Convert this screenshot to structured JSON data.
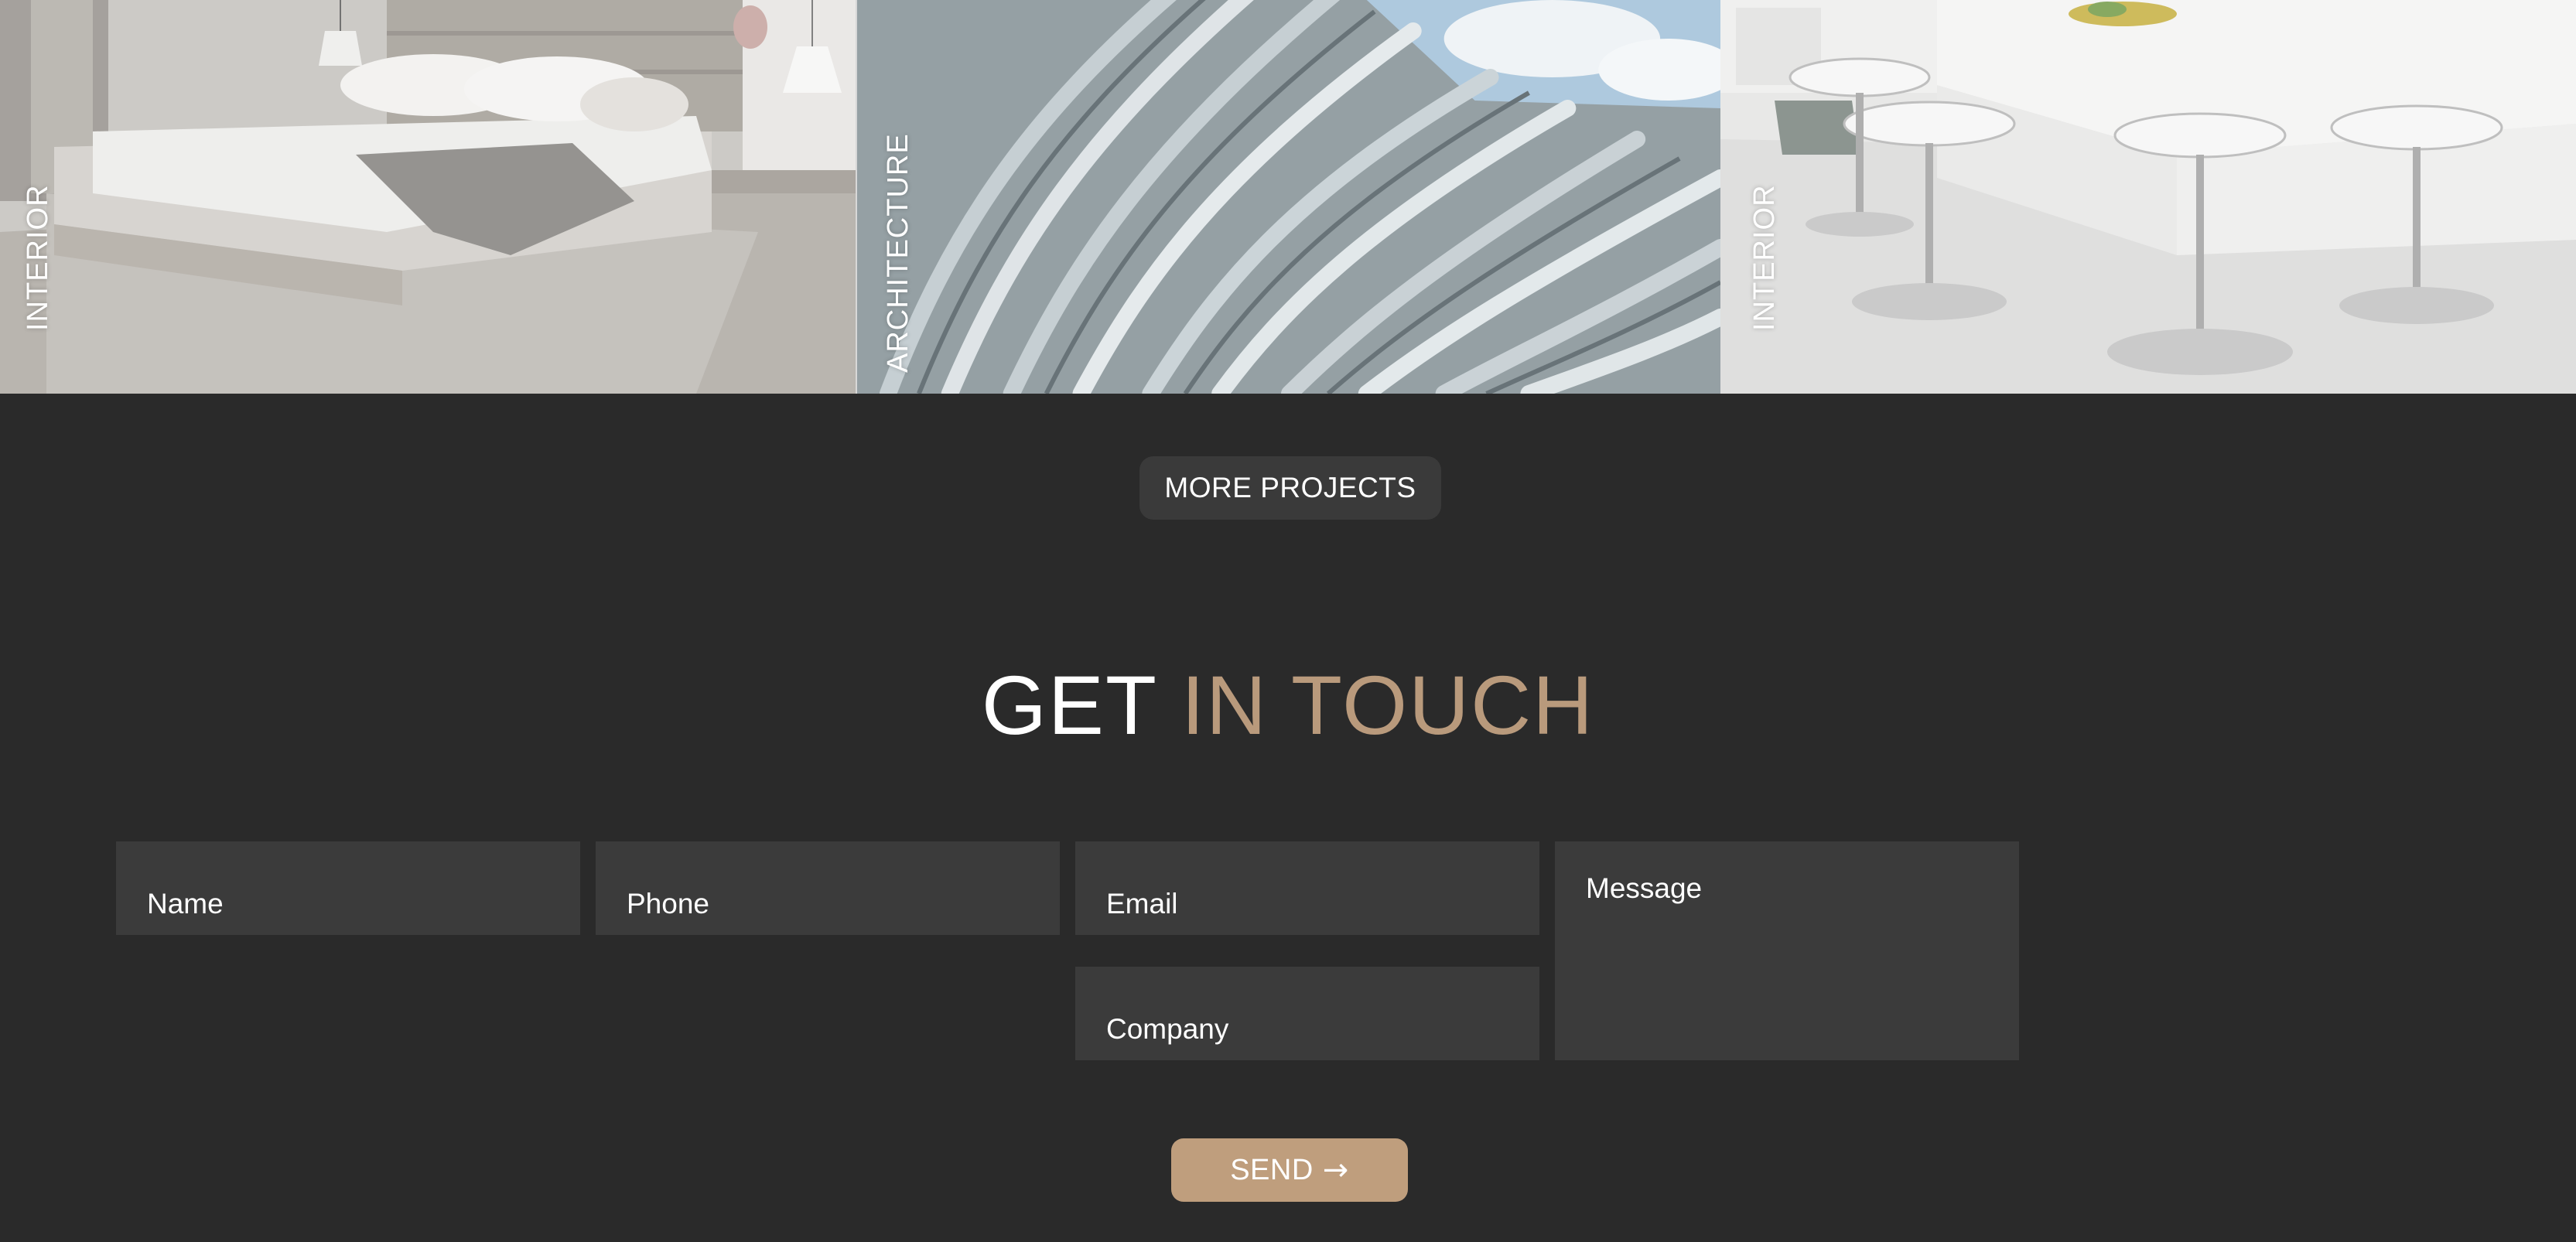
{
  "projects": [
    {
      "label": "INTERIOR",
      "scene": "bedroom"
    },
    {
      "label": "ARCHITECTURE",
      "scene": "facade"
    },
    {
      "label": "INTERIOR",
      "scene": "kitchen"
    }
  ],
  "more_projects": {
    "label": "MORE PROJECTS"
  },
  "contact": {
    "heading_plain": "GET",
    "heading_accent": "IN TOUCH",
    "fields": {
      "name": "Name",
      "phone": "Phone",
      "email": "Email",
      "company": "Company",
      "message": "Message"
    },
    "send_label": "SEND",
    "send_icon": "→"
  },
  "colors": {
    "background": "#2a2a2a",
    "accent": "#b99a7c",
    "field_bg": "#3b3b3b",
    "button_bg": "#3a3a3a",
    "send_bg": "#bf9e7d"
  }
}
